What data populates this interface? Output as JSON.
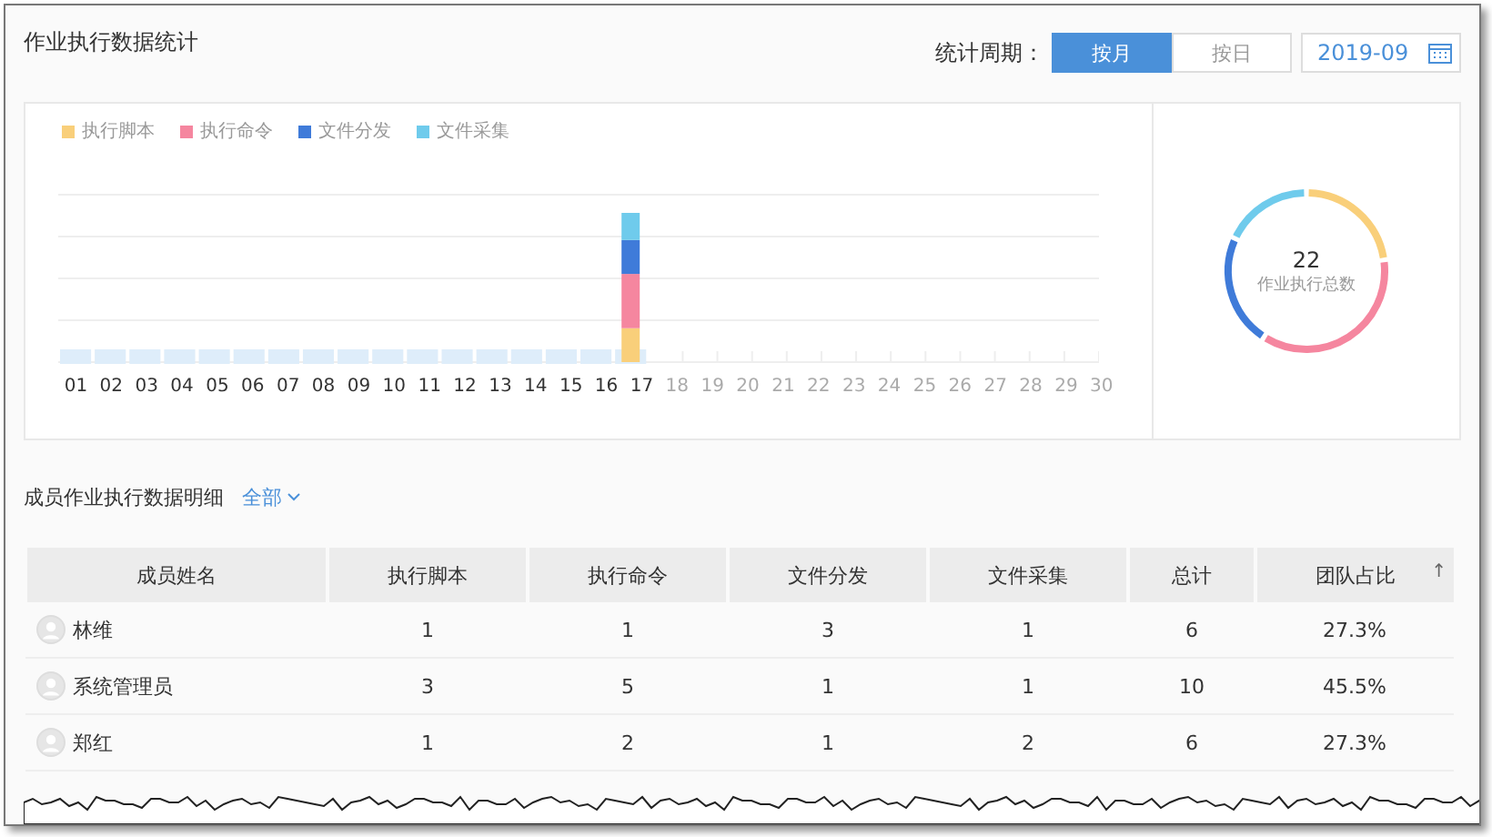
{
  "header": {
    "title": "作业执行数据统计",
    "period_label": "统计周期：",
    "period_tabs": [
      {
        "label": "按月",
        "selected": true
      },
      {
        "label": "按日",
        "selected": false
      }
    ],
    "month": "2019-09"
  },
  "chart": {
    "legend": [
      {
        "label": "执行脚本",
        "color": "#f9cf7a"
      },
      {
        "label": "执行命令",
        "color": "#f5869f"
      },
      {
        "label": "文件分发",
        "color": "#3f7bd9"
      },
      {
        "label": "文件采集",
        "color": "#6fcbec"
      }
    ],
    "days": [
      {
        "label": "01",
        "past": true
      },
      {
        "label": "02",
        "past": true
      },
      {
        "label": "03",
        "past": true
      },
      {
        "label": "04",
        "past": true
      },
      {
        "label": "05",
        "past": true
      },
      {
        "label": "06",
        "past": true
      },
      {
        "label": "07",
        "past": true
      },
      {
        "label": "08",
        "past": true
      },
      {
        "label": "09",
        "past": true
      },
      {
        "label": "10",
        "past": true
      },
      {
        "label": "11",
        "past": true
      },
      {
        "label": "12",
        "past": true
      },
      {
        "label": "13",
        "past": true
      },
      {
        "label": "14",
        "past": true
      },
      {
        "label": "15",
        "past": true
      },
      {
        "label": "16",
        "past": true
      },
      {
        "label": "17",
        "past": true
      },
      {
        "label": "18",
        "past": false
      },
      {
        "label": "19",
        "past": false
      },
      {
        "label": "20",
        "past": false
      },
      {
        "label": "21",
        "past": false
      },
      {
        "label": "22",
        "past": false
      },
      {
        "label": "23",
        "past": false
      },
      {
        "label": "24",
        "past": false
      },
      {
        "label": "25",
        "past": false
      },
      {
        "label": "26",
        "past": false
      },
      {
        "label": "27",
        "past": false
      },
      {
        "label": "28",
        "past": false
      },
      {
        "label": "29",
        "past": false
      },
      {
        "label": "30",
        "past": false
      }
    ],
    "total": "22",
    "total_label": "作业执行总数"
  },
  "detail": {
    "title": "成员作业执行数据明细",
    "filter": "全部"
  },
  "table": {
    "columns": [
      "成员姓名",
      "执行脚本",
      "执行命令",
      "文件分发",
      "文件采集",
      "总计",
      "团队占比"
    ],
    "sort_mark": "↑",
    "rows": [
      {
        "cells": [
          "林维",
          "1",
          "1",
          "3",
          "1",
          "6",
          "27.3%"
        ]
      },
      {
        "cells": [
          "系统管理员",
          "3",
          "5",
          "1",
          "1",
          "10",
          "45.5%"
        ]
      },
      {
        "cells": [
          "郑红",
          "1",
          "2",
          "1",
          "2",
          "6",
          "27.3%"
        ]
      }
    ]
  }
}
